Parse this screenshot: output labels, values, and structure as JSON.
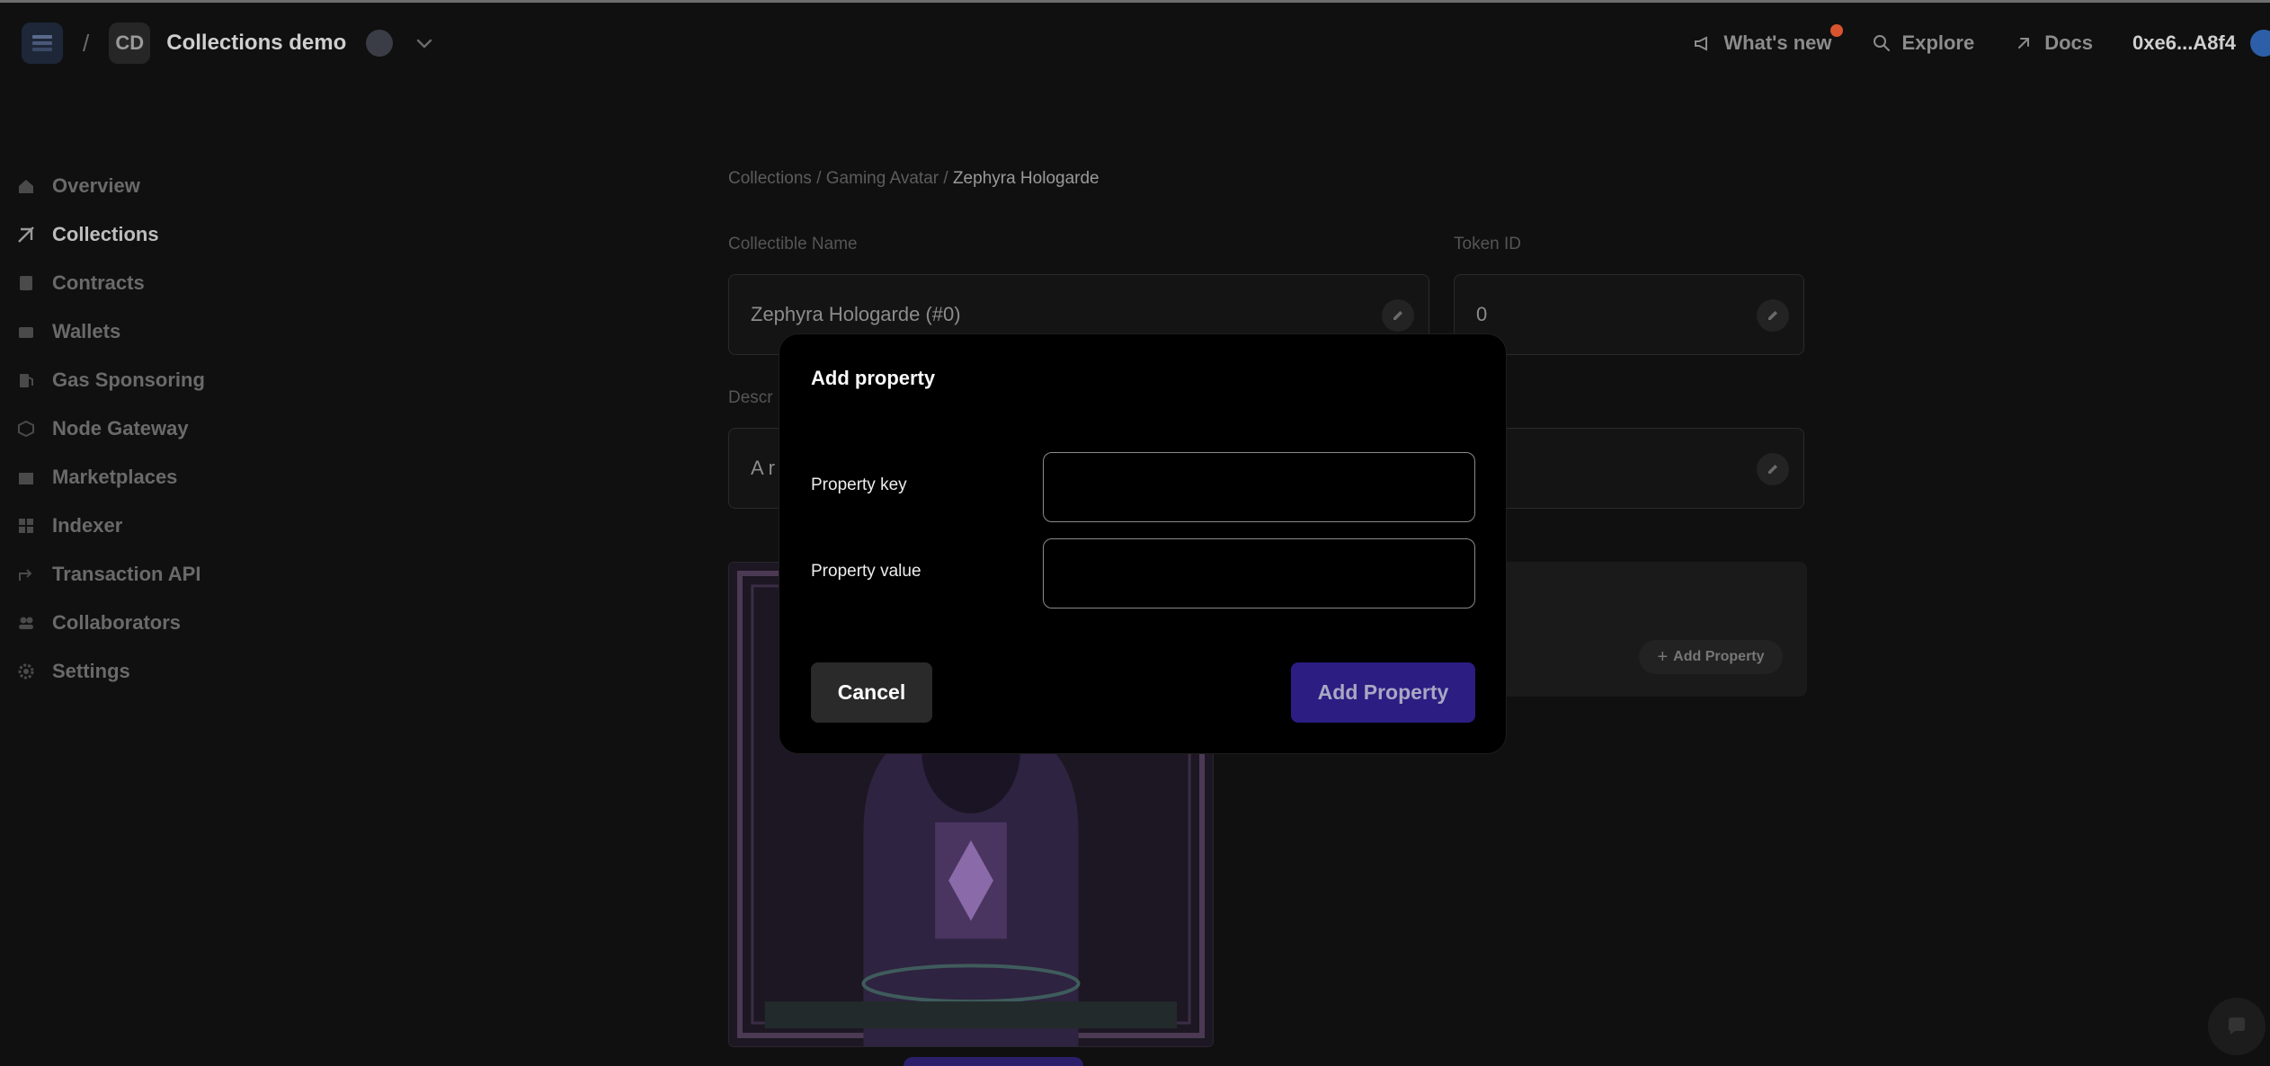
{
  "header": {
    "logo_icon": "layers-logo-icon",
    "separator": "/",
    "project_initials": "CD",
    "project_name": "Collections demo",
    "whats_new": "What's new",
    "explore": "Explore",
    "docs": "Docs",
    "wallet_address": "0xe6...A8f4"
  },
  "sidebar": {
    "items": [
      {
        "label": "Overview",
        "icon": "home-icon"
      },
      {
        "label": "Collections",
        "icon": "collections-icon",
        "active": true
      },
      {
        "label": "Contracts",
        "icon": "document-icon"
      },
      {
        "label": "Wallets",
        "icon": "wallet-icon"
      },
      {
        "label": "Gas Sponsoring",
        "icon": "gas-pump-icon"
      },
      {
        "label": "Node Gateway",
        "icon": "cube-icon"
      },
      {
        "label": "Marketplaces",
        "icon": "storefront-icon"
      },
      {
        "label": "Indexer",
        "icon": "grid-icon"
      },
      {
        "label": "Transaction API",
        "icon": "arrow-icon"
      },
      {
        "label": "Collaborators",
        "icon": "users-icon"
      },
      {
        "label": "Settings",
        "icon": "gear-icon"
      }
    ]
  },
  "main": {
    "breadcrumb": {
      "collections": "Collections",
      "sep": " / ",
      "collection": "Gaming Avatar",
      "current": "Zephyra Hologarde"
    },
    "collectible_name_label": "Collectible Name",
    "collectible_name_value": "Zephyra Hologarde (#0)",
    "token_id_label": "Token ID",
    "token_id_value": "0",
    "description_label_partial": "Descr",
    "description_value_partial": "A r",
    "add_property_small": "Add Property"
  },
  "modal": {
    "title": "Add property",
    "key_label": "Property key",
    "key_value": "",
    "value_label": "Property value",
    "value_value": "",
    "cancel_label": "Cancel",
    "submit_label": "Add Property"
  },
  "colors": {
    "primary_button": "#2b1d82",
    "background": "#101010",
    "modal_background": "#000000",
    "notification_dot": "#d9542e"
  }
}
